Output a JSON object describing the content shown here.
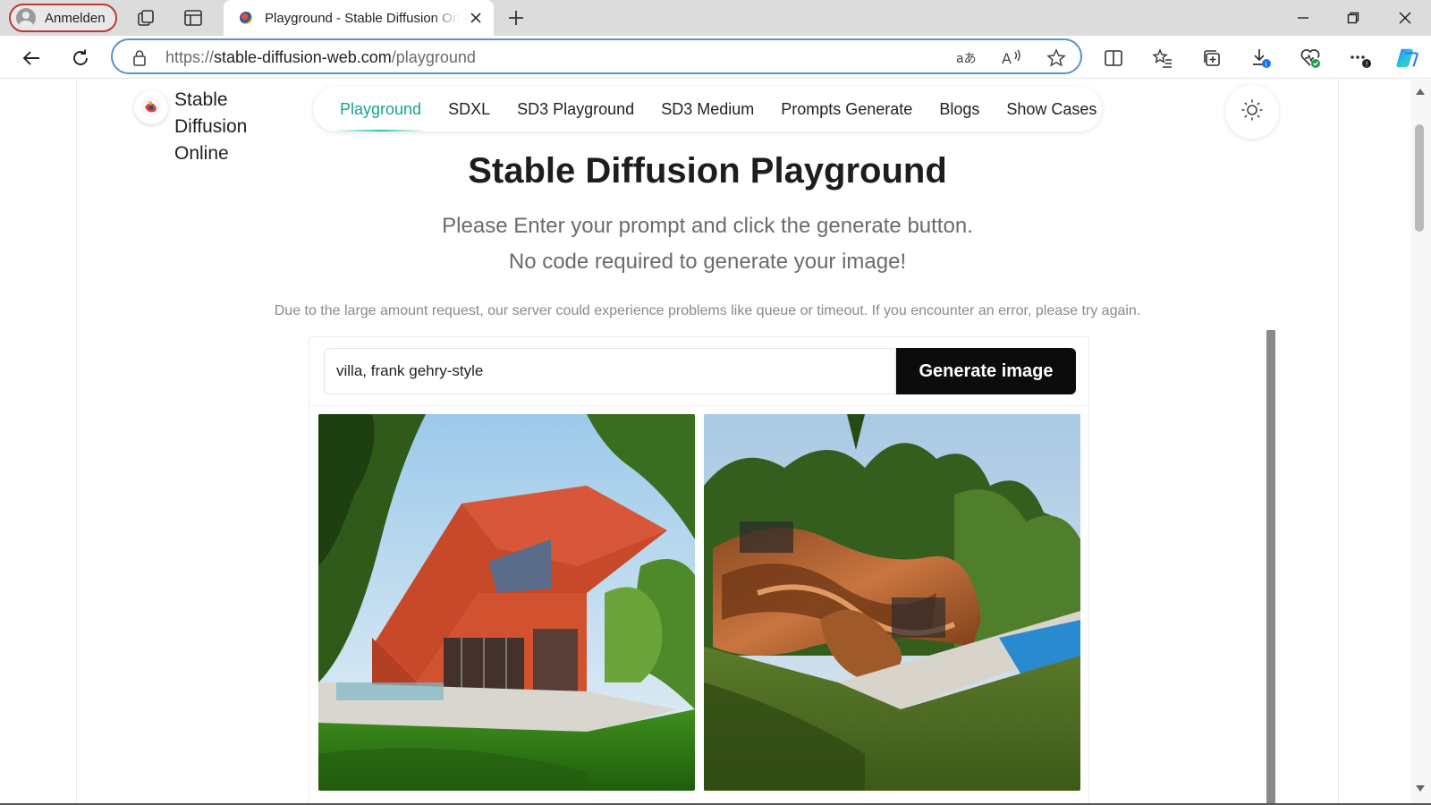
{
  "browser": {
    "profile_label": "Anmelden",
    "tab_title": "Playground - Stable Diffusion Online",
    "url_base": "https://stable-diffusion-web.com",
    "url_path": "/playground",
    "icons": [
      "workspaces-icon",
      "vertical-tabs-icon",
      "close-tab-icon",
      "new-tab-icon",
      "minimize-icon",
      "restore-icon",
      "close-window-icon",
      "back-icon",
      "refresh-icon",
      "lock-icon",
      "translate-icon",
      "read-aloud-icon",
      "favorite-icon",
      "split-screen-icon",
      "favorites-list-icon",
      "collections-icon",
      "downloads-icon",
      "browser-essentials-icon",
      "more-icon",
      "copilot-icon"
    ]
  },
  "site": {
    "brand_lines": [
      "Stable",
      "Diffusion",
      "Online"
    ],
    "nav": [
      {
        "label": "Playground",
        "active": true
      },
      {
        "label": "SDXL",
        "active": false
      },
      {
        "label": "SD3 Playground",
        "active": false
      },
      {
        "label": "SD3 Medium",
        "active": false
      },
      {
        "label": "Prompts Generate",
        "active": false
      },
      {
        "label": "Blogs",
        "active": false
      },
      {
        "label": "Show Cases",
        "active": false
      }
    ],
    "accent_color": "#16a394"
  },
  "main": {
    "title": "Stable Diffusion Playground",
    "subtitle_1": "Please Enter your prompt and click the generate button.",
    "subtitle_2": "No code required to generate your image!",
    "notice": "Due to the large amount request, our server could experience problems like queue or timeout. If you encounter an error, please try again.",
    "prompt_value": "villa, frank gehry-style",
    "generate_label": "Generate image",
    "images": [
      "generated-villa-image-1",
      "generated-villa-image-2"
    ]
  }
}
